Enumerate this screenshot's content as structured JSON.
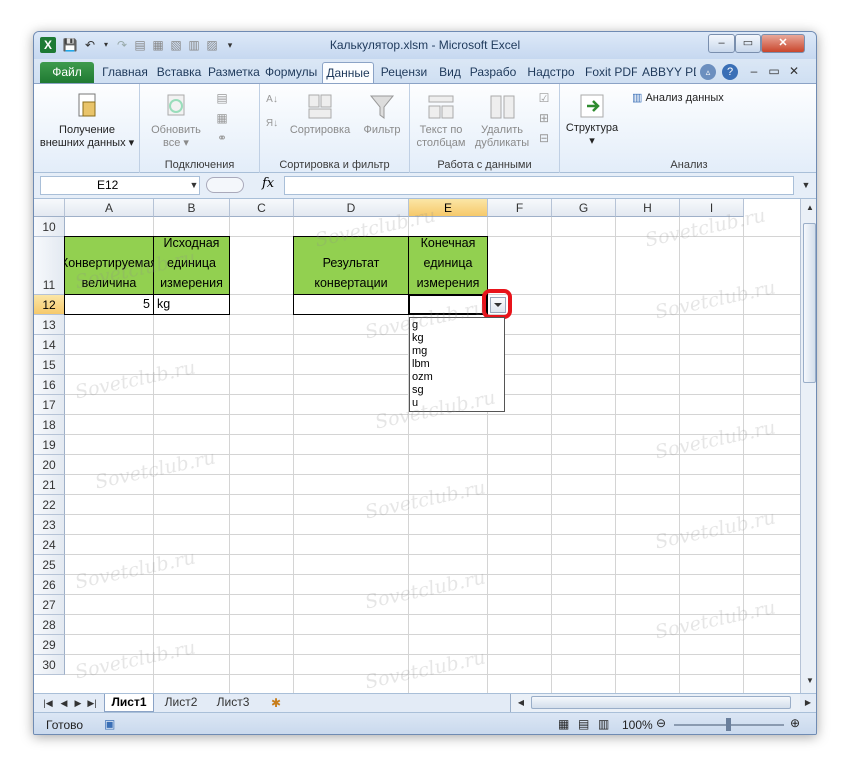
{
  "window": {
    "title": "Калькулятор.xlsm  -  Microsoft Excel",
    "controls": [
      "–",
      "▭",
      "✕"
    ]
  },
  "ribbon": {
    "file_tab": "Файл",
    "tabs": [
      "Главная",
      "Вставка",
      "Разметка",
      "Формулы",
      "Данные",
      "Рецензи",
      "Вид",
      "Разрабо",
      "Надстро",
      "Foxit PDF",
      "ABBYY PD"
    ],
    "active_tab": "Данные",
    "groups": {
      "get_external": {
        "label_line1": "Получение",
        "label_line2": "внешних данных"
      },
      "connections": {
        "label": "Подключения",
        "refresh_line1": "Обновить",
        "refresh_line2": "все"
      },
      "sort_filter": {
        "label": "Сортировка и фильтр",
        "sort": "Сортировка",
        "filter": "Фильтр"
      },
      "data_tools": {
        "label": "Работа с данными",
        "text_cols_line1": "Текст по",
        "text_cols_line2": "столбцам",
        "remove_dup_line1": "Удалить",
        "remove_dup_line2": "дубликаты"
      },
      "outline": {
        "label": "Структура"
      },
      "analysis": {
        "label": "Анализ",
        "data_analysis": "Анализ данных"
      }
    }
  },
  "formula_bar": {
    "name_box": "E12",
    "fx": "fx",
    "formula": ""
  },
  "columns": [
    "A",
    "B",
    "C",
    "D",
    "E",
    "F",
    "G",
    "H",
    "I"
  ],
  "selected_column": "E",
  "rows": [
    "10",
    "11",
    "12",
    "13",
    "14",
    "15",
    "16",
    "17",
    "18",
    "19",
    "20",
    "21",
    "22",
    "23",
    "24",
    "25",
    "26",
    "27",
    "28",
    "29",
    "30"
  ],
  "selected_row": "12",
  "cells": {
    "A11": "Конвертируемая величина",
    "B11": "Исходная единица измерения",
    "D11": "Результат конвертации",
    "E11": "Конечная единица измерения",
    "A12": "5",
    "B12": "kg",
    "D12": "",
    "E12": ""
  },
  "dropdown": {
    "options": [
      "g",
      "kg",
      "mg",
      "lbm",
      "ozm",
      "sg",
      "u"
    ]
  },
  "sheet_tabs": [
    "Лист1",
    "Лист2",
    "Лист3"
  ],
  "active_sheet": "Лист1",
  "status": {
    "ready": "Готово",
    "zoom": "100%"
  },
  "watermark": "Sovetclub.ru",
  "colors": {
    "header_fill": "#92d050",
    "highlight_ring": "#e8141b",
    "file_tab": "#2a8a3c"
  }
}
